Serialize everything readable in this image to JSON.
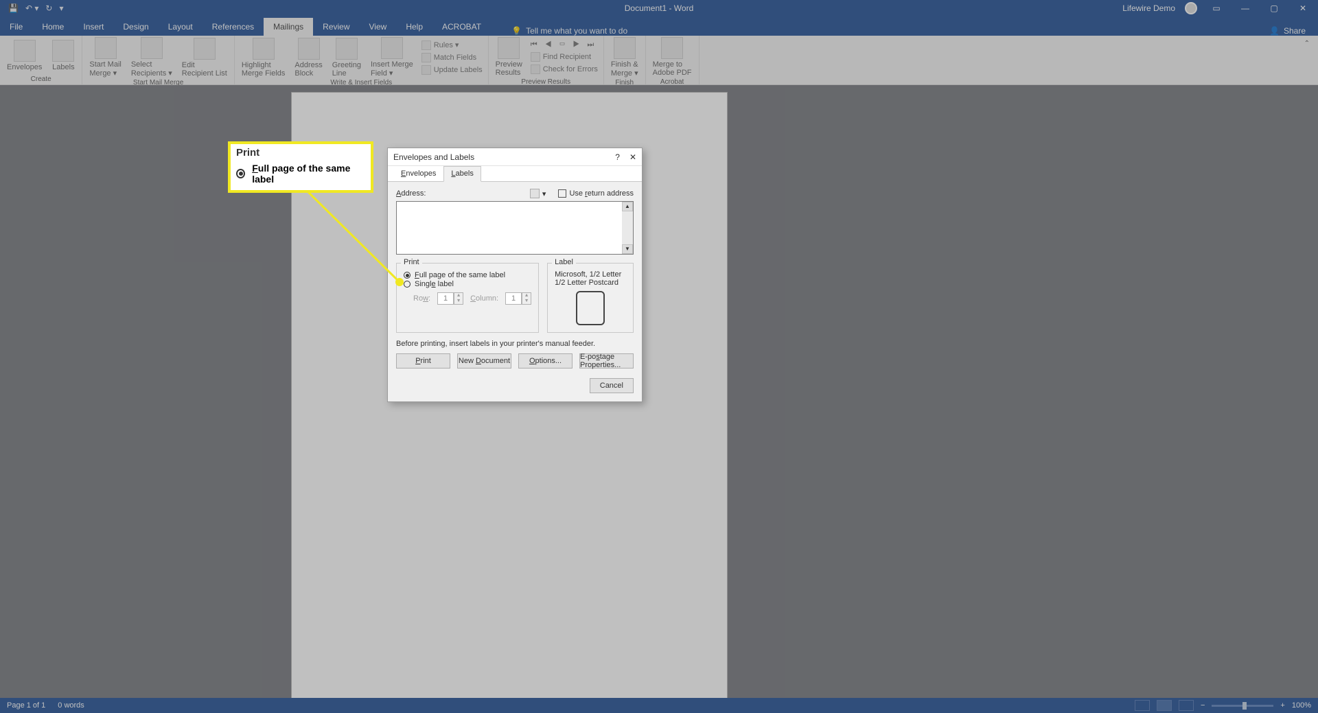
{
  "title": "Document1 - Word",
  "user_label": "Lifewire Demo",
  "share": "Share",
  "tabs": [
    "File",
    "Home",
    "Insert",
    "Design",
    "Layout",
    "References",
    "Mailings",
    "Review",
    "View",
    "Help",
    "ACROBAT"
  ],
  "tell_me": "Tell me what you want to do",
  "ribbon": {
    "create": {
      "env": "Envelopes",
      "lab": "Labels",
      "group": "Create"
    },
    "start": {
      "smm": "Start Mail\nMerge ▾",
      "sel": "Select\nRecipients ▾",
      "edit": "Edit\nRecipient List",
      "group": "Start Mail Merge"
    },
    "write": {
      "high": "Highlight\nMerge Fields",
      "addr": "Address\nBlock",
      "greet": "Greeting\nLine",
      "ins": "Insert Merge\nField ▾",
      "rules": "Rules ▾",
      "match": "Match Fields",
      "upd": "Update Labels",
      "group": "Write & Insert Fields"
    },
    "preview": {
      "prev": "Preview\nResults",
      "find": "Find Recipient",
      "check": "Check for Errors",
      "group": "Preview Results"
    },
    "finish": {
      "fin": "Finish &\nMerge ▾",
      "group": "Finish"
    },
    "acrobat": {
      "merge": "Merge to\nAdobe PDF",
      "group": "Acrobat"
    }
  },
  "dialog": {
    "title": "Envelopes and Labels",
    "tabs": {
      "env": "Envelopes",
      "lab": "Labels"
    },
    "address": "Address:",
    "use_return": "Use return address",
    "print_section": "Print",
    "opt_full": "Full page of the same label",
    "opt_single": "Single label",
    "row": "Row:",
    "row_v": "1",
    "col": "Column:",
    "col_v": "1",
    "label_section": "Label",
    "label_line1": "Microsoft, 1/2 Letter",
    "label_line2": "1/2 Letter Postcard",
    "hint": "Before printing, insert labels in your printer's manual feeder.",
    "btn_print": "Print",
    "btn_new": "New Document",
    "btn_opt": "Options...",
    "btn_epost": "E-postage Properties...",
    "btn_cancel": "Cancel"
  },
  "callout": {
    "title": "Print",
    "label": "Full page of the same label"
  },
  "status": {
    "page": "Page 1 of 1",
    "words": "0 words",
    "zoom": "100%"
  }
}
